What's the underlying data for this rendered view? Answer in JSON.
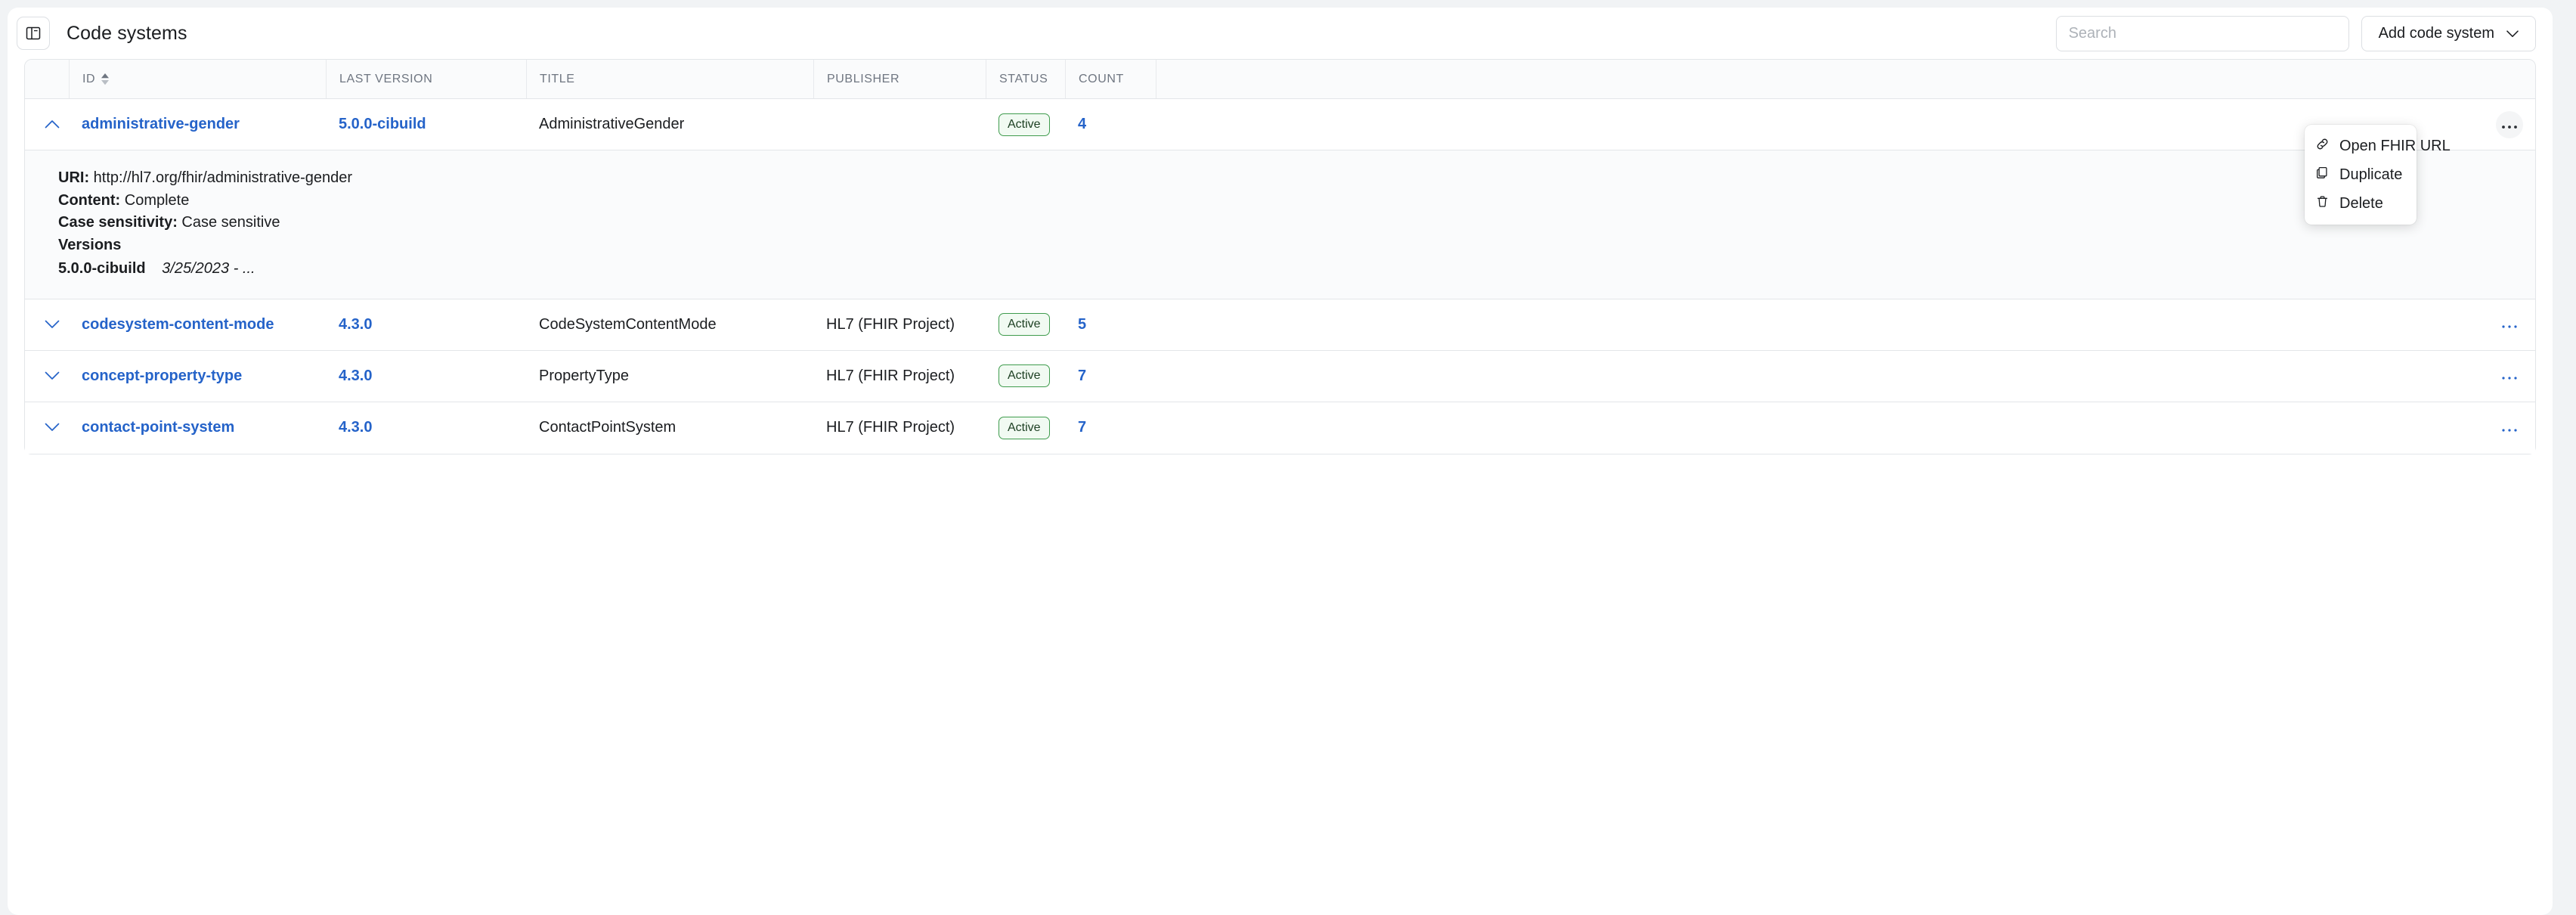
{
  "header": {
    "title": "Code systems",
    "toggle_icon": "panel-layout-icon",
    "search_placeholder": "Search",
    "search_value": "",
    "add_button_label": "Add code system",
    "add_button_icon": "chevron-down-icon"
  },
  "table": {
    "columns": [
      {
        "key": "id",
        "label": "ID",
        "sortable": true,
        "sort_icon": "sort-arrows-icon"
      },
      {
        "key": "last_version",
        "label": "LAST VERSION",
        "sortable": false
      },
      {
        "key": "title",
        "label": "TITLE",
        "sortable": false
      },
      {
        "key": "publisher",
        "label": "PUBLISHER",
        "sortable": false
      },
      {
        "key": "status",
        "label": "STATUS",
        "sortable": false
      },
      {
        "key": "count",
        "label": "COUNT",
        "sortable": false
      }
    ],
    "rows": [
      {
        "expanded": true,
        "caret_icon": "chevron-up-icon",
        "id": "administrative-gender",
        "last_version": "5.0.0-cibuild",
        "title": "AdministrativeGender",
        "publisher": "",
        "status": "Active",
        "count": "4",
        "kebab_icon": "ellipsis-icon",
        "detail": {
          "uri_label": "URI:",
          "uri_value": "http://hl7.org/fhir/administrative-gender",
          "content_label": "Content:",
          "content_value": "Complete",
          "case_label": "Case sensitivity:",
          "case_value": "Case sensitive",
          "versions_label": "Versions",
          "version_name": "5.0.0-cibuild",
          "version_date": "3/25/2023 - ..."
        }
      },
      {
        "expanded": false,
        "caret_icon": "chevron-down-icon",
        "id": "codesystem-content-mode",
        "last_version": "4.3.0",
        "title": "CodeSystemContentMode",
        "publisher": "HL7 (FHIR Project)",
        "status": "Active",
        "count": "5",
        "kebab_icon": "ellipsis-icon"
      },
      {
        "expanded": false,
        "caret_icon": "chevron-down-icon",
        "id": "concept-property-type",
        "last_version": "4.3.0",
        "title": "PropertyType",
        "publisher": "HL7 (FHIR Project)",
        "status": "Active",
        "count": "7",
        "kebab_icon": "ellipsis-icon"
      },
      {
        "expanded": false,
        "caret_icon": "chevron-down-icon",
        "id": "contact-point-system",
        "last_version": "4.3.0",
        "title": "ContactPointSystem",
        "publisher": "HL7 (FHIR Project)",
        "status": "Active",
        "count": "7",
        "kebab_icon": "ellipsis-icon"
      }
    ]
  },
  "context_menu": {
    "visible": true,
    "items": [
      {
        "label": "Open FHIR URL",
        "icon": "link-icon"
      },
      {
        "label": "Duplicate",
        "icon": "copy-icon"
      },
      {
        "label": "Delete",
        "icon": "trash-icon"
      }
    ]
  },
  "colors": {
    "link": "#2563c9",
    "status_border": "#3f9c4d",
    "status_bg": "#f1faf2",
    "page_bg": "#f1f3f5",
    "header_text": "#6f7681"
  }
}
